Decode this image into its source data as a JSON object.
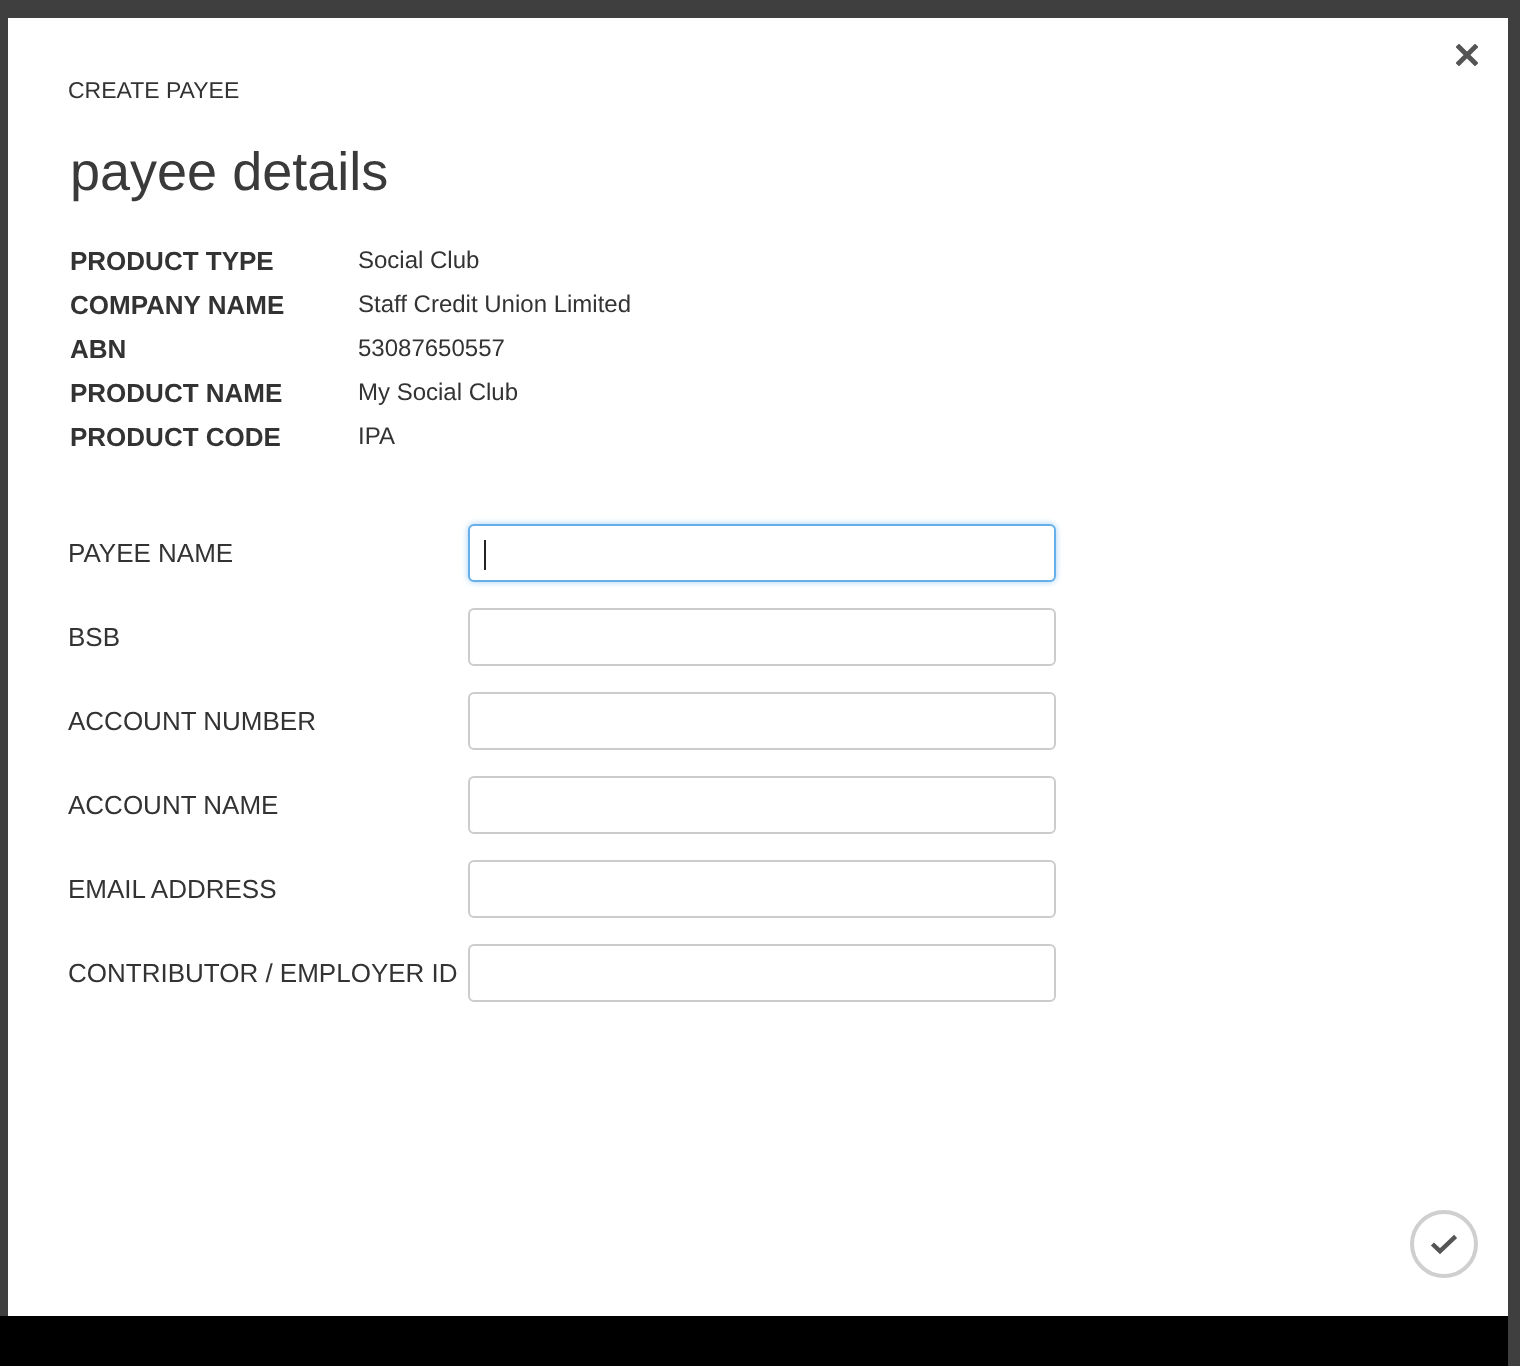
{
  "dialog": {
    "subtitle": "CREATE PAYEE",
    "title": "payee details"
  },
  "details": [
    {
      "label": "PRODUCT TYPE",
      "value": "Social Club"
    },
    {
      "label": "COMPANY NAME",
      "value": "Staff Credit Union Limited"
    },
    {
      "label": "ABN",
      "value": "53087650557"
    },
    {
      "label": "PRODUCT NAME",
      "value": "My Social Club"
    },
    {
      "label": "PRODUCT CODE",
      "value": "IPA"
    }
  ],
  "fields": [
    {
      "label": "PAYEE NAME",
      "focused": true
    },
    {
      "label": "BSB",
      "focused": false
    },
    {
      "label": "ACCOUNT NUMBER",
      "focused": false
    },
    {
      "label": "ACCOUNT NAME",
      "focused": false
    },
    {
      "label": "EMAIL ADDRESS",
      "focused": false
    },
    {
      "label": "CONTRIBUTOR / EMPLOYER ID",
      "focused": false
    }
  ]
}
